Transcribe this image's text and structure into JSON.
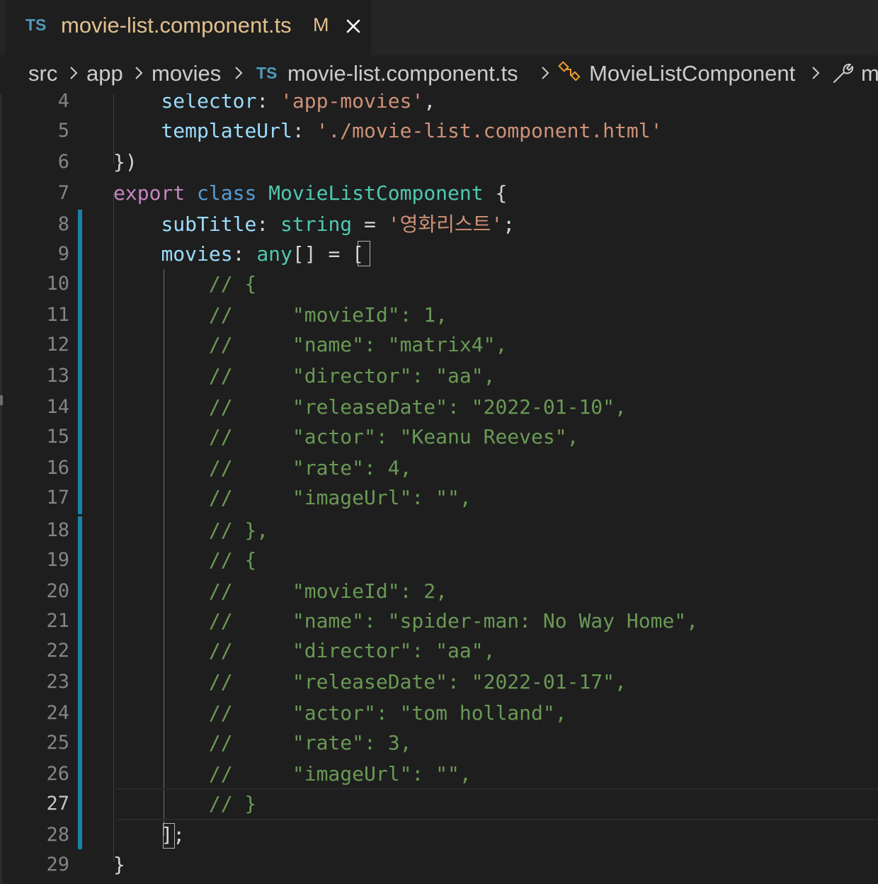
{
  "tab": {
    "lang_badge": "TS",
    "title": "movie-list.component.ts",
    "modified": "M",
    "close_icon": "close-icon"
  },
  "breadcrumb": {
    "items": [
      "src",
      "app",
      "movies",
      "movie-list.component.ts",
      "MovieListComponent",
      "m"
    ],
    "file_lang_badge": "TS",
    "class_icon": "class-icon",
    "method_icon": "wrench-icon"
  },
  "colors": {
    "keyword_purple": "#c586c0",
    "keyword_blue": "#569cd6",
    "type": "#4ec9b0",
    "property": "#9cdcfe",
    "string": "#ce9178",
    "comment": "#6a9955",
    "gutter_modified": "#1b81a8",
    "tab_title": "#e2c08d"
  },
  "editor": {
    "active_line": "27",
    "lines": [
      {
        "n": "4",
        "t": "    selector: 'app-movies',"
      },
      {
        "n": "5",
        "t": "    templateUrl: './movie-list.component.html'"
      },
      {
        "n": "6",
        "t": "})"
      },
      {
        "n": "7",
        "t": "export class MovieListComponent {"
      },
      {
        "n": "8",
        "t": "    subTitle: string = '영화리스트';"
      },
      {
        "n": "9",
        "t": "    movies: any[] = ["
      },
      {
        "n": "10",
        "t": "        // {"
      },
      {
        "n": "11",
        "t": "        //     \"movieId\": 1,"
      },
      {
        "n": "12",
        "t": "        //     \"name\": \"matrix4\","
      },
      {
        "n": "13",
        "t": "        //     \"director\": \"aa\","
      },
      {
        "n": "14",
        "t": "        //     \"releaseDate\": \"2022-01-10\","
      },
      {
        "n": "15",
        "t": "        //     \"actor\": \"Keanu Reeves\","
      },
      {
        "n": "16",
        "t": "        //     \"rate\": 4,"
      },
      {
        "n": "17",
        "t": "        //     \"imageUrl\": \"\","
      },
      {
        "n": "18",
        "t": "        // },"
      },
      {
        "n": "19",
        "t": "        // {"
      },
      {
        "n": "20",
        "t": "        //     \"movieId\": 2,"
      },
      {
        "n": "21",
        "t": "        //     \"name\": \"spider-man: No Way Home\","
      },
      {
        "n": "22",
        "t": "        //     \"director\": \"aa\","
      },
      {
        "n": "23",
        "t": "        //     \"releaseDate\": \"2022-01-17\","
      },
      {
        "n": "24",
        "t": "        //     \"actor\": \"tom holland\","
      },
      {
        "n": "25",
        "t": "        //     \"rate\": 3,"
      },
      {
        "n": "26",
        "t": "        //     \"imageUrl\": \"\","
      },
      {
        "n": "27",
        "t": "        // }"
      },
      {
        "n": "28",
        "t": "    ];"
      },
      {
        "n": "29",
        "t": "}"
      }
    ]
  }
}
